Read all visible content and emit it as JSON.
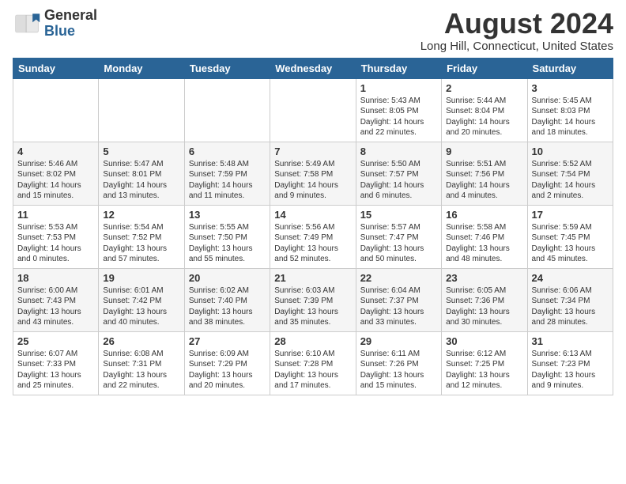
{
  "logo": {
    "general": "General",
    "blue": "Blue"
  },
  "title": "August 2024",
  "location": "Long Hill, Connecticut, United States",
  "days": [
    "Sunday",
    "Monday",
    "Tuesday",
    "Wednesday",
    "Thursday",
    "Friday",
    "Saturday"
  ],
  "weeks": [
    [
      {
        "date": "",
        "info": ""
      },
      {
        "date": "",
        "info": ""
      },
      {
        "date": "",
        "info": ""
      },
      {
        "date": "",
        "info": ""
      },
      {
        "date": "1",
        "info": "Sunrise: 5:43 AM\nSunset: 8:05 PM\nDaylight: 14 hours\nand 22 minutes."
      },
      {
        "date": "2",
        "info": "Sunrise: 5:44 AM\nSunset: 8:04 PM\nDaylight: 14 hours\nand 20 minutes."
      },
      {
        "date": "3",
        "info": "Sunrise: 5:45 AM\nSunset: 8:03 PM\nDaylight: 14 hours\nand 18 minutes."
      }
    ],
    [
      {
        "date": "4",
        "info": "Sunrise: 5:46 AM\nSunset: 8:02 PM\nDaylight: 14 hours\nand 15 minutes."
      },
      {
        "date": "5",
        "info": "Sunrise: 5:47 AM\nSunset: 8:01 PM\nDaylight: 14 hours\nand 13 minutes."
      },
      {
        "date": "6",
        "info": "Sunrise: 5:48 AM\nSunset: 7:59 PM\nDaylight: 14 hours\nand 11 minutes."
      },
      {
        "date": "7",
        "info": "Sunrise: 5:49 AM\nSunset: 7:58 PM\nDaylight: 14 hours\nand 9 minutes."
      },
      {
        "date": "8",
        "info": "Sunrise: 5:50 AM\nSunset: 7:57 PM\nDaylight: 14 hours\nand 6 minutes."
      },
      {
        "date": "9",
        "info": "Sunrise: 5:51 AM\nSunset: 7:56 PM\nDaylight: 14 hours\nand 4 minutes."
      },
      {
        "date": "10",
        "info": "Sunrise: 5:52 AM\nSunset: 7:54 PM\nDaylight: 14 hours\nand 2 minutes."
      }
    ],
    [
      {
        "date": "11",
        "info": "Sunrise: 5:53 AM\nSunset: 7:53 PM\nDaylight: 14 hours\nand 0 minutes."
      },
      {
        "date": "12",
        "info": "Sunrise: 5:54 AM\nSunset: 7:52 PM\nDaylight: 13 hours\nand 57 minutes."
      },
      {
        "date": "13",
        "info": "Sunrise: 5:55 AM\nSunset: 7:50 PM\nDaylight: 13 hours\nand 55 minutes."
      },
      {
        "date": "14",
        "info": "Sunrise: 5:56 AM\nSunset: 7:49 PM\nDaylight: 13 hours\nand 52 minutes."
      },
      {
        "date": "15",
        "info": "Sunrise: 5:57 AM\nSunset: 7:47 PM\nDaylight: 13 hours\nand 50 minutes."
      },
      {
        "date": "16",
        "info": "Sunrise: 5:58 AM\nSunset: 7:46 PM\nDaylight: 13 hours\nand 48 minutes."
      },
      {
        "date": "17",
        "info": "Sunrise: 5:59 AM\nSunset: 7:45 PM\nDaylight: 13 hours\nand 45 minutes."
      }
    ],
    [
      {
        "date": "18",
        "info": "Sunrise: 6:00 AM\nSunset: 7:43 PM\nDaylight: 13 hours\nand 43 minutes."
      },
      {
        "date": "19",
        "info": "Sunrise: 6:01 AM\nSunset: 7:42 PM\nDaylight: 13 hours\nand 40 minutes."
      },
      {
        "date": "20",
        "info": "Sunrise: 6:02 AM\nSunset: 7:40 PM\nDaylight: 13 hours\nand 38 minutes."
      },
      {
        "date": "21",
        "info": "Sunrise: 6:03 AM\nSunset: 7:39 PM\nDaylight: 13 hours\nand 35 minutes."
      },
      {
        "date": "22",
        "info": "Sunrise: 6:04 AM\nSunset: 7:37 PM\nDaylight: 13 hours\nand 33 minutes."
      },
      {
        "date": "23",
        "info": "Sunrise: 6:05 AM\nSunset: 7:36 PM\nDaylight: 13 hours\nand 30 minutes."
      },
      {
        "date": "24",
        "info": "Sunrise: 6:06 AM\nSunset: 7:34 PM\nDaylight: 13 hours\nand 28 minutes."
      }
    ],
    [
      {
        "date": "25",
        "info": "Sunrise: 6:07 AM\nSunset: 7:33 PM\nDaylight: 13 hours\nand 25 minutes."
      },
      {
        "date": "26",
        "info": "Sunrise: 6:08 AM\nSunset: 7:31 PM\nDaylight: 13 hours\nand 22 minutes."
      },
      {
        "date": "27",
        "info": "Sunrise: 6:09 AM\nSunset: 7:29 PM\nDaylight: 13 hours\nand 20 minutes."
      },
      {
        "date": "28",
        "info": "Sunrise: 6:10 AM\nSunset: 7:28 PM\nDaylight: 13 hours\nand 17 minutes."
      },
      {
        "date": "29",
        "info": "Sunrise: 6:11 AM\nSunset: 7:26 PM\nDaylight: 13 hours\nand 15 minutes."
      },
      {
        "date": "30",
        "info": "Sunrise: 6:12 AM\nSunset: 7:25 PM\nDaylight: 13 hours\nand 12 minutes."
      },
      {
        "date": "31",
        "info": "Sunrise: 6:13 AM\nSunset: 7:23 PM\nDaylight: 13 hours\nand 9 minutes."
      }
    ]
  ]
}
